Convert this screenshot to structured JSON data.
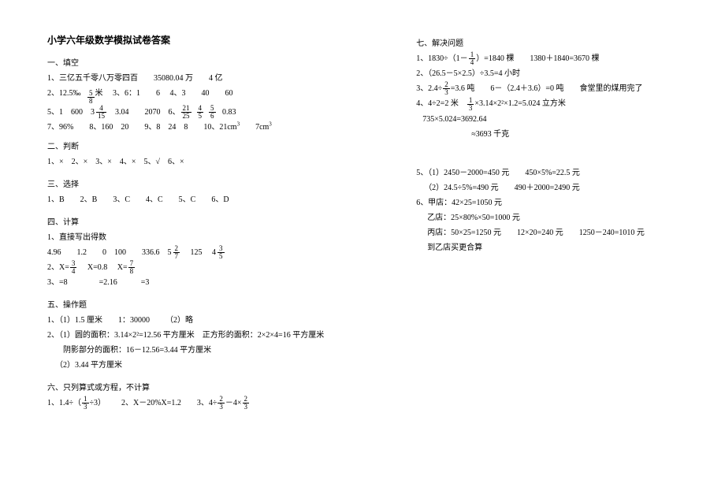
{
  "title": "小学六年级数学模拟试卷答案",
  "s1h": "一、填空",
  "s1l1": "1、三亿五千零八万零四百  35080.04 万  4 亿",
  "s1l2a": "2、12.5‰",
  "s1l2b": "米",
  "s1l2c": "3、6：1  6",
  "s1l2d": "4、3  40  60",
  "s1l3a": "5、1 600",
  "s1l3b": "3.04  2070",
  "s1l3c": "6、",
  "s1l3d": "0.83",
  "s1l4": "7、96%  8、160 20  9、8 24 8  10、21",
  "s1l4cm3a": "cm",
  "s1l4sp": "  7",
  "s1l4cm3b": "cm",
  "s2h": "二、判断",
  "s2l1": "1、× 2、× 3、× 4、× 5、√ 6、×",
  "s3h": "三、选择",
  "s3l1": "1、B  2、B  3、C  4、C  5、C  6、D",
  "s4h": "四、计算",
  "s4sub1": "1、直接写出得数",
  "s4l1a": "4.96  1.2  0 100  336.6",
  "s4l1b": "125",
  "s4l2a": "2、X=",
  "s4l2b": "X=0.8",
  "s4l2c": "X=",
  "s4l3": "3、=8    =2.16   =3",
  "s5h": "五、操作题",
  "s5l1": "1、（1）1.5 厘米  1：30000  （2）略",
  "s5l2": "2、（1）圆的面积：3.14×2²=12.56 平方厘米 正方形的面积：2×2×4=16 平方厘米",
  "s5l3": "阴影部分的面积：16－12.56=3.44 平方厘米",
  "s5l4": "（2）3.44 平方厘米",
  "s6h": "六、只列算式或方程，不计算",
  "s6l1a": "1、1.4÷（",
  "s6l1b": "÷3）  2、X－20%X=1.2  3、4÷",
  "s6l1c": "－4×",
  "s7h": "七、解决问题",
  "s7l1a": "1、1830÷（1－",
  "s7l1b": "）=1840 棵  1380＋1840=3670 棵",
  "s7l2": "2、（26.5－5×2.5）÷3.5=4 小时",
  "s7l3a": "3、2.4÷",
  "s7l3b": "=3.6 吨  6－（2.4＋3.6）=0 吨  食堂里的煤用完了",
  "s7l4a": "4、4÷2=2 米 ",
  "s7l4b": "×3.14×2²×1.2=5.024 立方米",
  "s7l5": "735×5.024=3692.64",
  "s7l6": "≈3693 千克",
  "s7l7a": "5、（1）2450－2000=450 元  450×5%=22.5 元",
  "s7l7b": "（2）24.5÷5%=490 元  490＋2000=2490 元",
  "s7l8": "6、甲店：42×25=1050 元",
  "s7l9": "乙店：25×80%×50=1000 元",
  "s7l10": "丙店：50×25=1250 元  12×20=240 元  1250－240=1010 元",
  "s7l11": "到乙店买更合算"
}
